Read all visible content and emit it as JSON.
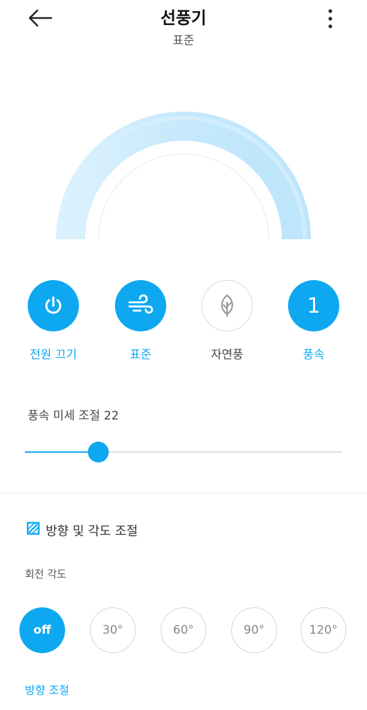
{
  "header": {
    "title": "선풍기",
    "subtitle": "표준",
    "back_icon": "arrow-left-icon",
    "more_icon": "more-vertical-icon"
  },
  "colors": {
    "accent": "#0ea8f0",
    "arc_light": "#bfe6fb",
    "inactive_border": "#d8d8d8"
  },
  "modes": {
    "power": {
      "label": "전원 끄기",
      "icon": "power-icon",
      "active": true
    },
    "standard": {
      "label": "표준",
      "icon": "wind-icon",
      "active": true
    },
    "natural": {
      "label": "자연풍",
      "icon": "leaf-icon",
      "active": false
    },
    "speed": {
      "label": "풍속",
      "value": "1",
      "active": true
    }
  },
  "fine_speed": {
    "label": "풍속 미세 조절 22",
    "value": 22
  },
  "direction": {
    "title": "방향 및 각도 조절",
    "icon": "direction-box-icon",
    "rotation_label": "회전 각도",
    "angles": [
      "off",
      "30°",
      "60°",
      "90°",
      "120°"
    ],
    "selected": "off",
    "link": "방향 조절"
  }
}
